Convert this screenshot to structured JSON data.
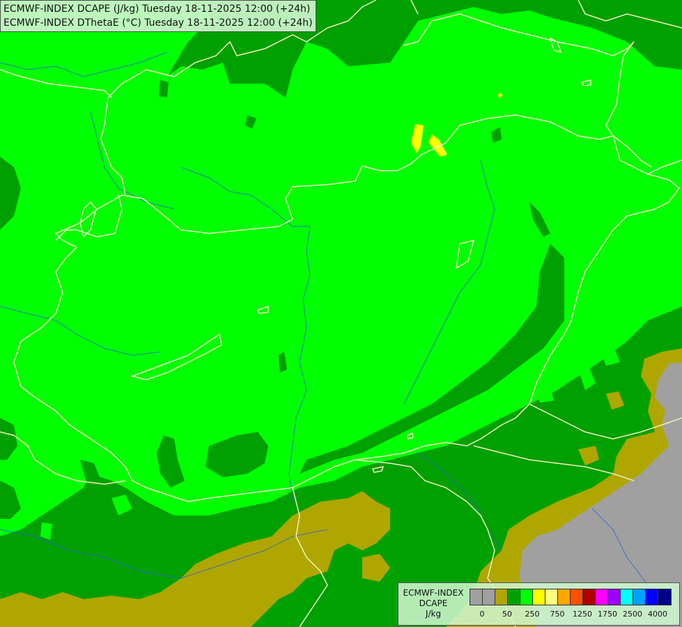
{
  "header": {
    "line1": "ECMWF-INDEX DCAPE (J/kg) Tuesday 18-11-2025 12:00 (+24h)",
    "line2": "ECMWF-INDEX DThetaE (°C) Tuesday 18-11-2025 12:00 (+24h)"
  },
  "legend": {
    "label_line1": "ECMWF-INDEX",
    "label_line2": "DCAPE",
    "label_line3": "J/kg",
    "swatches": [
      "#a0a0a0",
      "#a0a0a0",
      "#b0a600",
      "#00a000",
      "#00ff00",
      "#ffff00",
      "#ffff80",
      "#ffa500",
      "#ff5000",
      "#b00000",
      "#ff00ff",
      "#a000ff",
      "#00ffff",
      "#00a0ff",
      "#0000ff",
      "#00008b"
    ],
    "ticks": [
      "0",
      "50",
      "250",
      "750",
      "1250",
      "1750",
      "2500",
      "4000"
    ]
  },
  "colors": {
    "light_green": "#00ff00",
    "dark_green": "#00a000",
    "olive": "#b0a600",
    "gray": "#a0a0a0",
    "yellow": "#ffff00",
    "border": "#f0f0c0",
    "river": "#3060d0"
  }
}
